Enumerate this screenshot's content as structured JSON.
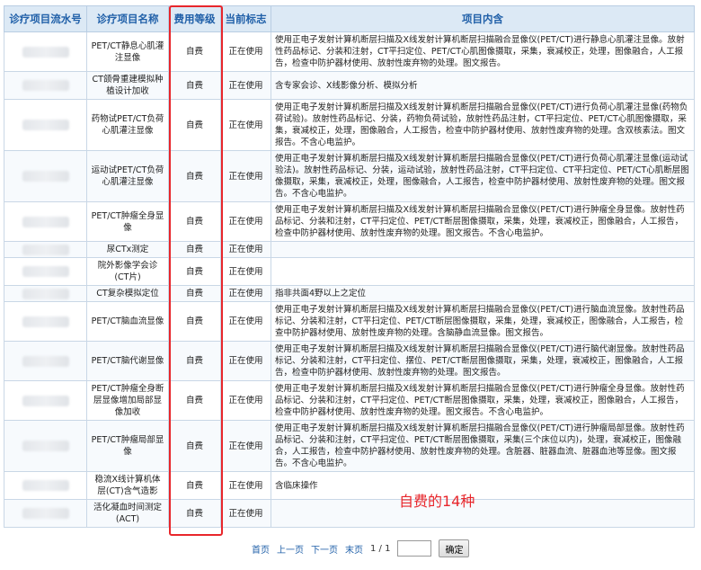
{
  "table": {
    "headers": [
      "诊疗项目流水号",
      "诊疗项目名称",
      "费用等级",
      "当前标志",
      "项目内含"
    ],
    "rows": [
      {
        "name": "PET/CT静息心肌灌注显像",
        "fee": "自费",
        "status": "正在使用",
        "content": "使用正电子发射计算机断层扫描及X线发射计算机断层扫描融合显像仪(PET/CT)进行静息心肌灌注显像。放射性药品标记、分装和注射，CT平扫定位、PET/CT心肌图像摄取，采集，衰减校正，处理，图像融合，人工报告，检查中防护器材使用、放射性废弃物的处理。图文报告。"
      },
      {
        "name": "CT颌骨重建模拟种植设计加收",
        "fee": "自费",
        "status": "正在使用",
        "content": "含专家会诊、X线影像分析、模拟分析"
      },
      {
        "name": "药物试PET/CT负荷心肌灌注显像",
        "fee": "自费",
        "status": "正在使用",
        "content": "使用正电子发射计算机断层扫描及X线发射计算机断层扫描融合显像仪(PET/CT)进行负荷心肌灌注显像(药物负荷试验)。放射性药品标记、分装，药物负荷试验，放射性药品注射，CT平扫定位、PET/CT心肌图像摄取，采集，衰减校正，处理，图像融合，人工报告，检查中防护器材使用、放射性废弃物的处理。含双核素法。图文报告。不含心电监护。"
      },
      {
        "name": "运动试PET/CT负荷心肌灌注显像",
        "fee": "自费",
        "status": "正在使用",
        "content": "使用正电子发射计算机断层扫描及X线发射计算机断层扫描融合显像仪(PET/CT)进行负荷心肌灌注显像(运动试验法)。放射性药品标记、分装，运动试验，放射性药品注射，CT平扫定位、CT平扫定位、PET/CT心肌断层图像摄取，采集，衰减校正，处理，图像融合，人工报告，检查中防护器材使用、放射性废弃物的处理。图文报告。不含心电监护。"
      },
      {
        "name": "PET/CT肿瘤全身显像",
        "fee": "自费",
        "status": "正在使用",
        "content": "使用正电子发射计算机断层扫描及X线发射计算机断层扫描融合显像仪(PET/CT)进行肿瘤全身显像。放射性药品标记、分装和注射，CT平扫定位、PET/CT断层图像摄取，采集，处理，衰减校正，图像融合，人工报告，检查中防护器材使用、放射性废弃物的处理。图文报告。不含心电监护。"
      },
      {
        "name": "尿CTx测定",
        "fee": "自费",
        "status": "正在使用",
        "content": ""
      },
      {
        "name": "院外影像学会诊(CT片)",
        "fee": "自费",
        "status": "正在使用",
        "content": ""
      },
      {
        "name": "CT复杂模拟定位",
        "fee": "自费",
        "status": "正在使用",
        "content": "指非共面4野以上之定位"
      },
      {
        "name": "PET/CT脑血流显像",
        "fee": "自费",
        "status": "正在使用",
        "content": "使用正电子发射计算机断层扫描及X线发射计算机断层扫描融合显像仪(PET/CT)进行脑血流显像。放射性药品标记、分装和注射，CT平扫定位、PET/CT断层图像摄取，采集，处理，衰减校正，图像融合，人工报告，检查中防护器材使用、放射性废弃物的处理。含脑静血流显像。图文报告。"
      },
      {
        "name": "PET/CT脑代谢显像",
        "fee": "自费",
        "status": "正在使用",
        "content": "使用正电子发射计算机断层扫描及X线发射计算机断层扫描融合显像仪(PET/CT)进行脑代谢显像。放射性药品标记、分装和注射，CT平扫定位、摆位、PET/CT断层图像摄取，采集，处理，衰减校正，图像融合，人工报告，检查中防护器材使用、放射性废弃物的处理。图文报告。"
      },
      {
        "name": "PET/CT肿瘤全身断层显像增加局部显像加收",
        "fee": "自费",
        "status": "正在使用",
        "content": "使用正电子发射计算机断层扫描及X线发射计算机断层扫描融合显像仪(PET/CT)进行肿瘤全身显像。放射性药品标记、分装和注射，CT平扫定位、PET/CT断层图像摄取，采集，处理，衰减校正，图像融合，人工报告，检查中防护器材使用、放射性废弃物的处理。图文报告。不含心电监护。"
      },
      {
        "name": "PET/CT肿瘤局部显像",
        "fee": "自费",
        "status": "正在使用",
        "content": "使用正电子发射计算机断层扫描及X线发射计算机断层扫描融合显像仪(PET/CT)进行肿瘤局部显像。放射性药品标记、分装和注射，CT平扫定位、PET/CT断层图像摄取，采集(三个床位以内)，处理，衰减校正，图像融合，人工报告，检查中防护器材使用、放射性废弃物的处理。含脏器、脏器血流、脏器血池等显像。图文报告。不含心电监护。"
      },
      {
        "name": "稳流X线计算机体层(CT)含气造影",
        "fee": "自费",
        "status": "正在使用",
        "content": "含临床操作"
      },
      {
        "name": "活化凝血时间测定(ACT)",
        "fee": "自费",
        "status": "正在使用",
        "content": ""
      }
    ]
  },
  "annotation": "自费的14种",
  "pager": {
    "first": "首页",
    "prev": "上一页",
    "next": "下一页",
    "last": "末页",
    "page_info": "1 / 1",
    "page_input": "",
    "go_button": "确定"
  },
  "colors": {
    "header_bg": "#dce9f5",
    "header_text": "#1f5fa8",
    "highlight": "#e8262b",
    "link": "#1f5fa8"
  }
}
